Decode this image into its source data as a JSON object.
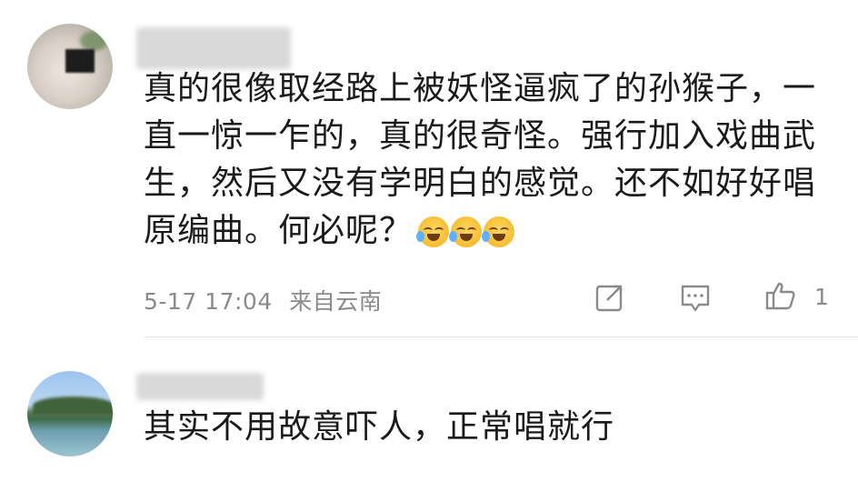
{
  "comments": [
    {
      "text": "真的很像取经路上被妖怪逼疯了的孙猴子，一直一惊一乍的，真的很奇怪。强行加入戏曲武生，然后又没有学明白的感觉。还不如好好唱原编曲。何必呢？",
      "emojis": [
        "laugh-cry-emoji",
        "laugh-cry-emoji",
        "laugh-cry-emoji"
      ],
      "timestamp": "5-17 17:04",
      "location": "来自云南",
      "likes": "1"
    },
    {
      "text": "其实不用故意吓人，正常唱就行"
    }
  ]
}
